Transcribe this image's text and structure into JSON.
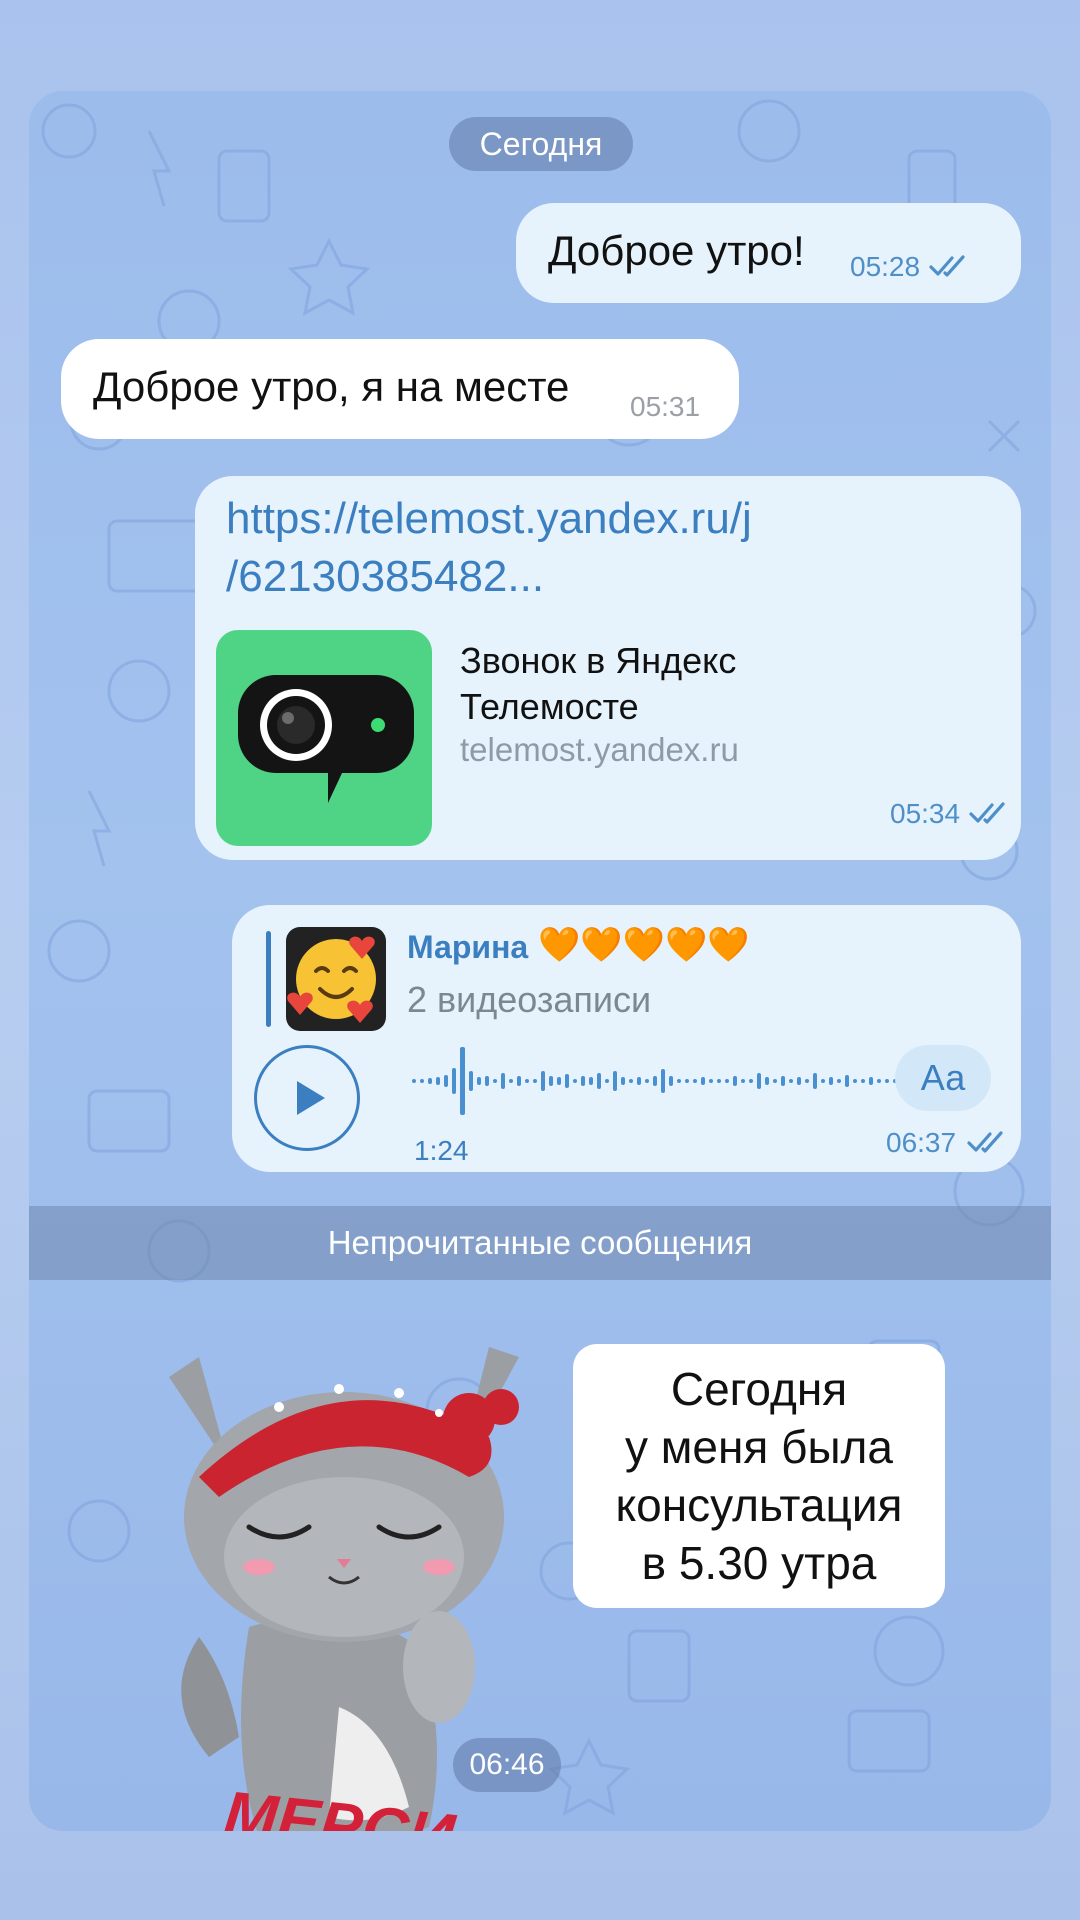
{
  "date_header": "Сегодня",
  "messages": {
    "m1": {
      "text": "Доброе утро!",
      "time": "05:28"
    },
    "m2": {
      "text": "Доброе утро, я на месте",
      "time": "05:31"
    },
    "m3": {
      "link_line1": "https://telemost.yandex.ru/j",
      "link_line2": "/62130385482...",
      "preview_title_line1": "Звонок в Яндекс",
      "preview_title_line2": "Телемосте",
      "preview_domain": "telemost.yandex.ru",
      "time": "05:34"
    },
    "m4": {
      "reply_author": "Марина",
      "reply_emoji": "🧡🧡🧡🧡🧡",
      "reply_text": "2 видеозаписи",
      "duration": "1:24",
      "transcribe_label": "Аа",
      "time": "06:37"
    }
  },
  "unread_divider": "Непрочитанные сообщения",
  "incoming": {
    "text_lines": [
      "Сегодня",
      "у меня была",
      "консультация",
      "в 5.30 утра"
    ],
    "sticker_caption": "МЕРСИ",
    "time": "06:46"
  },
  "colors": {
    "accent": "#3b7fc1",
    "outgoing_bubble": "#e6f3fc",
    "incoming_bubble": "#ffffff",
    "preview_icon_bg": "#4fd486"
  }
}
